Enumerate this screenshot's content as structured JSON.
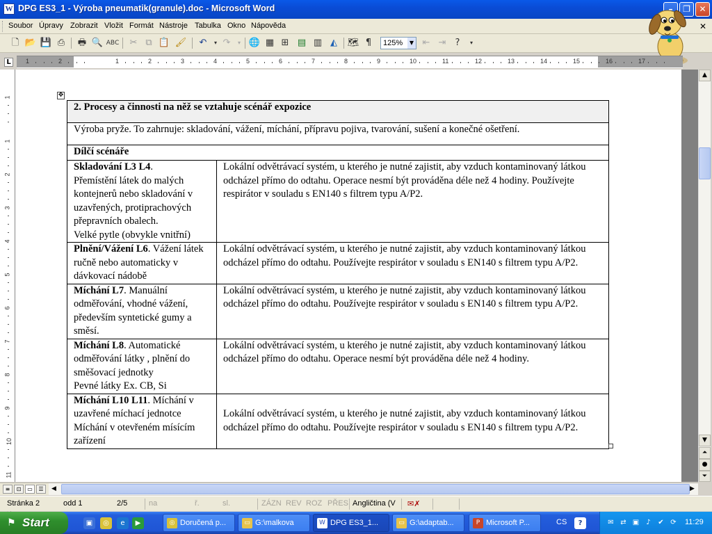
{
  "window": {
    "title": "DPG ES3_1 - Výroba pneumatik(granule).doc - Microsoft Word",
    "app_icon": "W"
  },
  "menu": [
    "Soubor",
    "Úpravy",
    "Zobrazit",
    "Vložit",
    "Formát",
    "Nástroje",
    "Tabulka",
    "Okno",
    "Nápověda"
  ],
  "toolbar": {
    "zoom": "125%"
  },
  "ruler": {
    "h_numbers": [
      "1",
      "2",
      "1",
      "2",
      "3",
      "4",
      "5",
      "6",
      "7",
      "8",
      "9",
      "10",
      "11",
      "12",
      "13",
      "14",
      "15",
      "16",
      "17"
    ],
    "v_numbers": [
      "1",
      "1",
      "2",
      "3",
      "4",
      "5",
      "6",
      "7",
      "8",
      "9",
      "10",
      "11",
      "12"
    ]
  },
  "doc": {
    "heading": "2. Procesy a činnosti na něž se vztahuje scénář expozice",
    "intro": "Výroba pryže. To zahrnuje: skladování, vážení, míchání, přípravu pojiva, tvarování, sušení a konečné ošetření.",
    "subscenarios_label": "Dílčí scénáře",
    "rows": [
      {
        "title": "Skladování L3 L4",
        "desc": ".\nPřemístění látek do malých kontejnerů nebo skladování v uzavřených, protiprachových přepravních obalech.\nVelké pytle (obvykle vnitřní)",
        "measure": "Lokální odvětrávací systém, u kterého je nutné zajistit, aby vzduch kontaminovaný látkou odcházel přímo do odtahu. Operace nesmí být prováděna déle než 4 hodiny. Používejte respirátor v souladu s EN140 s filtrem typu A/P2."
      },
      {
        "title": "Plnění/Vážení L6",
        "desc": ". Vážení látek ručně nebo automaticky v dávkovací nádobě",
        "measure": "Lokální odvětrávací systém, u kterého je nutné zajistit, aby vzduch kontaminovaný látkou odcházel přímo do odtahu. Používejte respirátor v souladu s EN140 s filtrem typu A/P2."
      },
      {
        "title": "Míchání L7",
        "desc": ". Manuální odměřování, vhodné vážení, především syntetické gumy a směsí.",
        "measure": "Lokální odvětrávací systém, u kterého je nutné zajistit, aby vzduch kontaminovaný látkou odcházel přímo do odtahu. Používejte respirátor v souladu s EN140 s filtrem typu A/P2."
      },
      {
        "title": "Míchání L8",
        "desc": ". Automatické odměřování látky , plnění do směšovací jednotky\nPevné látky Ex. CB, Si",
        "measure": "Lokální odvětrávací systém, u kterého je nutné zajistit, aby vzduch kontaminovaný látkou odcházel přímo do odtahu. Operace nesmí být prováděna déle než 4 hodiny."
      },
      {
        "title": "Míchání L10 L11",
        "desc": ". Míchání v uzavřené míchací jednotce\nMíchání v otevřeném mísícím zařízení",
        "measure": "Lokální odvětrávací systém, u kterého je nutné zajistit, aby vzduch kontaminovaný látkou odcházel přímo do odtahu. Používejte respirátor v souladu s EN140 s filtrem typu A/P2."
      }
    ]
  },
  "status": {
    "page": "Stránka 2",
    "section": "odd 1",
    "pages": "2/5",
    "at": "na",
    "line": "ř.",
    "col": "sl.",
    "rec": "ZÁZN",
    "trk": "REV",
    "ext": "ROZ",
    "ovr": "PŘES",
    "language": "Angličtina (V"
  },
  "taskbar": {
    "start": "Start",
    "tasks": [
      {
        "label": "Doručená p...",
        "icon_color": "#d9c23a"
      },
      {
        "label": "G:\\malkova",
        "icon_color": "#e8c34a"
      },
      {
        "label": "DPG ES3_1...",
        "icon_color": "#2a4fb8",
        "active": true
      },
      {
        "label": "G:\\adaptab...",
        "icon_color": "#e8c34a"
      },
      {
        "label": "Microsoft P...",
        "icon_color": "#c8462a"
      }
    ],
    "lang": "CS",
    "clock": "11:29"
  }
}
